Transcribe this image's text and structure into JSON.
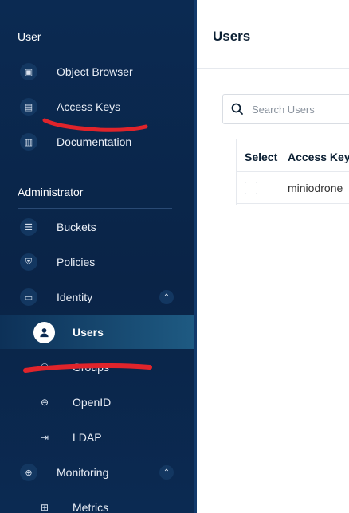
{
  "sidebar": {
    "user_section": "User",
    "user_items": [
      {
        "label": "Object Browser",
        "icon": "object-browser-icon"
      },
      {
        "label": "Access Keys",
        "icon": "access-keys-icon"
      },
      {
        "label": "Documentation",
        "icon": "documentation-icon"
      }
    ],
    "admin_section": "Administrator",
    "admin_items": [
      {
        "label": "Buckets",
        "icon": "buckets-icon"
      },
      {
        "label": "Policies",
        "icon": "policies-icon"
      },
      {
        "label": "Identity",
        "icon": "identity-icon",
        "expanded": true
      }
    ],
    "identity_children": [
      {
        "label": "Users",
        "icon": "user-icon",
        "active": true
      },
      {
        "label": "Groups",
        "icon": "groups-icon"
      },
      {
        "label": "OpenID",
        "icon": "openid-icon"
      },
      {
        "label": "LDAP",
        "icon": "ldap-icon"
      }
    ],
    "monitoring": {
      "label": "Monitoring",
      "icon": "monitoring-icon",
      "expanded": true
    },
    "monitoring_children": [
      {
        "label": "Metrics",
        "icon": "metrics-icon"
      }
    ]
  },
  "main": {
    "title": "Users",
    "search_placeholder": "Search Users",
    "table": {
      "columns": [
        "Select",
        "Access Key"
      ],
      "rows": [
        {
          "access_key": "miniodrone"
        }
      ]
    }
  },
  "colors": {
    "sidebar_bg": "#0b2a52",
    "active_item": "#1e5a82",
    "annotation": "#e0242b"
  }
}
